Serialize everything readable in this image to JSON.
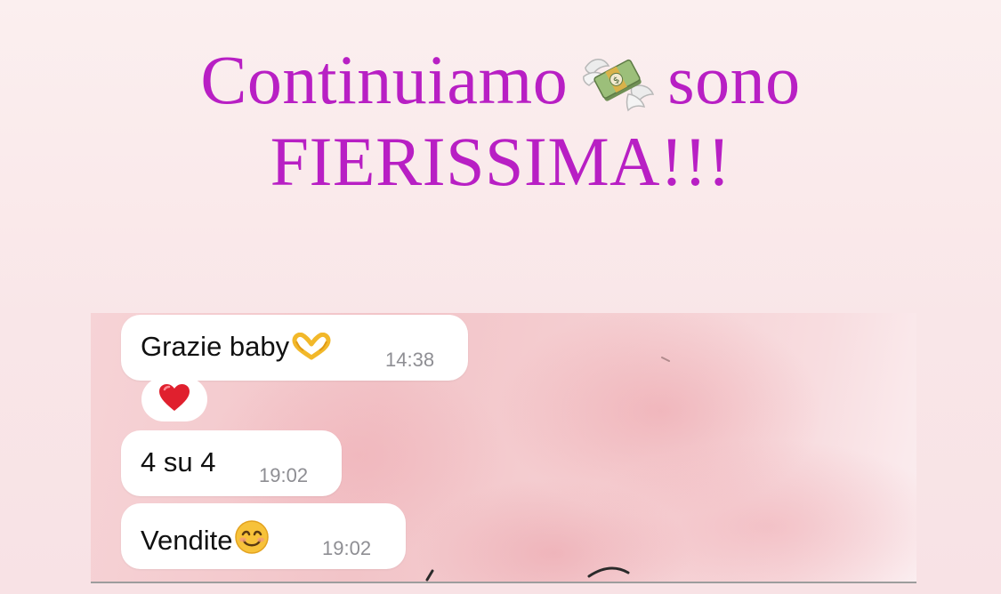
{
  "headline": {
    "line1_before": "Continuiamo",
    "line1_icon": "money-with-wings-icon",
    "line1_after": "sono",
    "line2": "FIERISSIMA!!!",
    "color": "#b81fc4"
  },
  "chat": {
    "messages": [
      {
        "text": "Grazie baby",
        "emoji": "heart-hands-icon",
        "time": "14:38"
      },
      {
        "text": "4 su 4",
        "emoji": "",
        "time": "19:02"
      },
      {
        "text": "Vendite",
        "emoji": "smiling-face-icon",
        "time": "19:02"
      }
    ],
    "reaction": {
      "emoji": "red-heart-icon"
    }
  }
}
